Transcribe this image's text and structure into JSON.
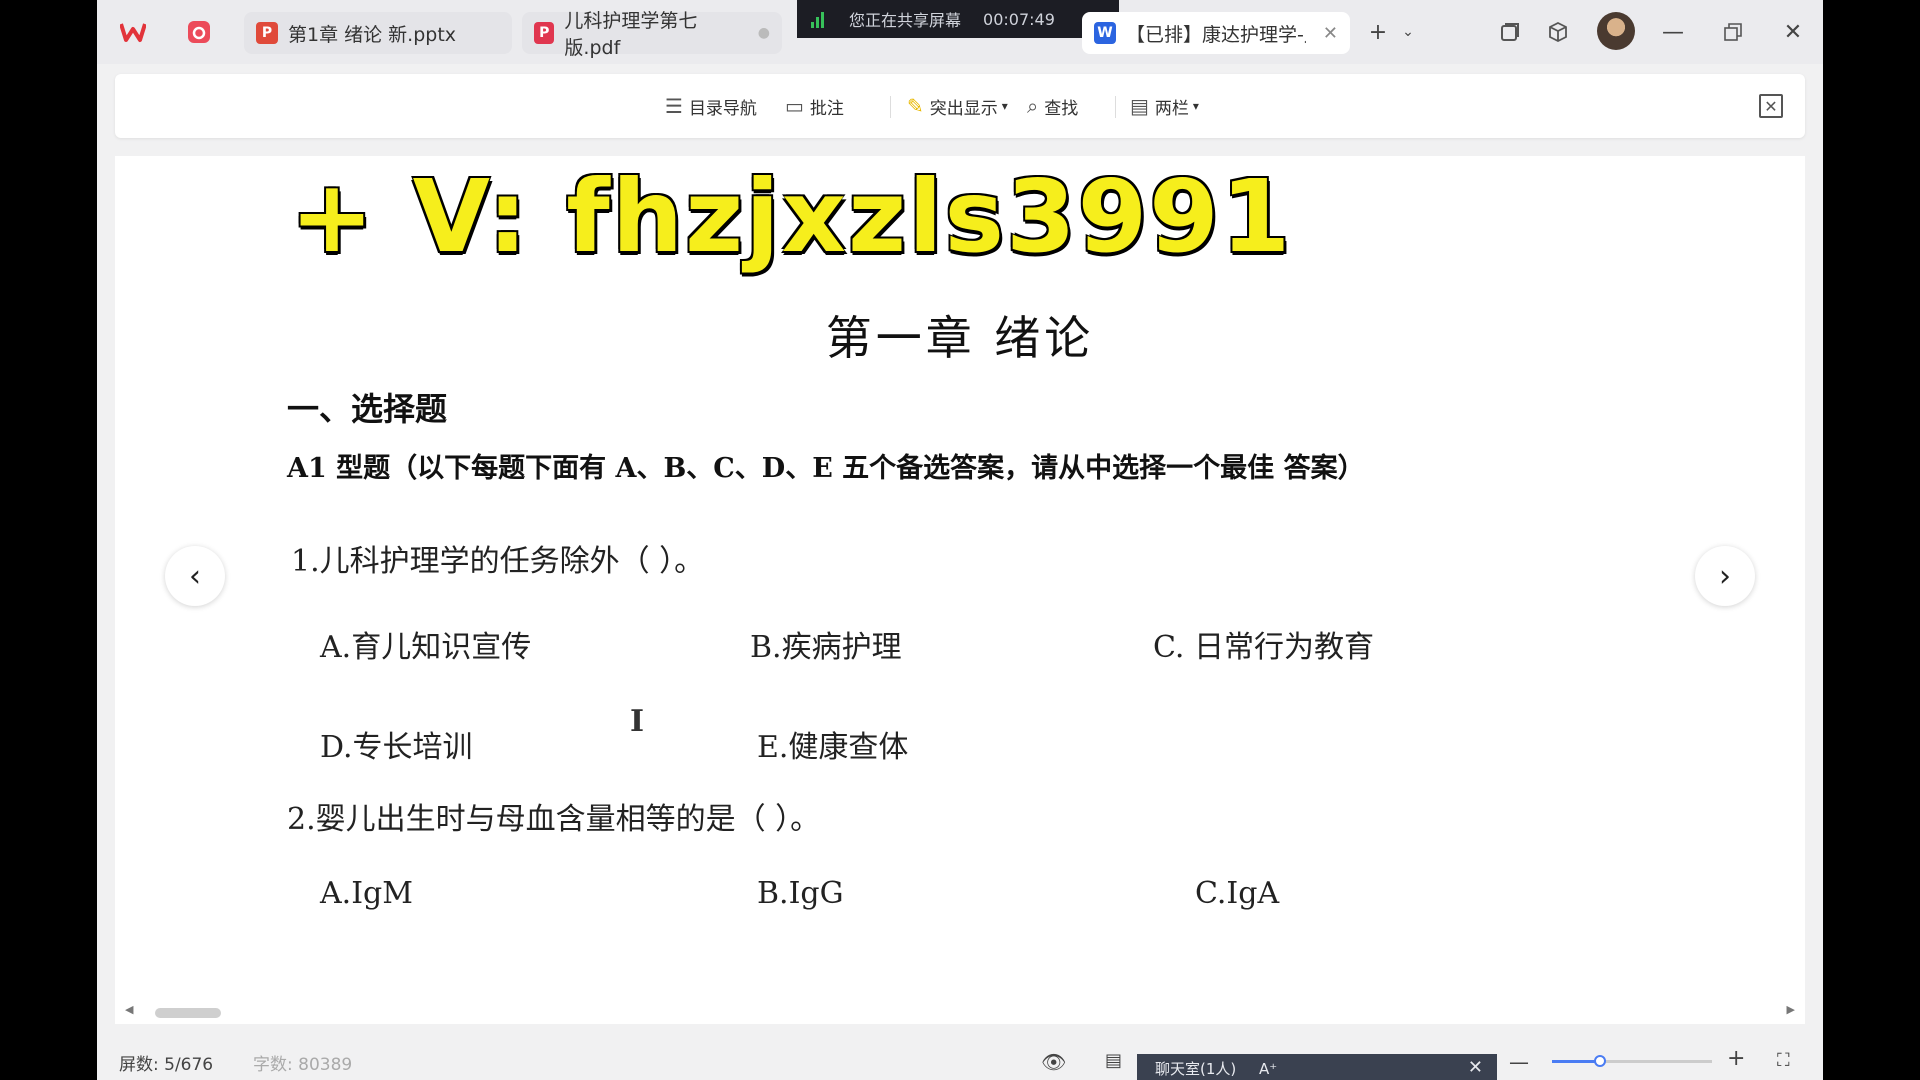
{
  "tabs": [
    {
      "label": "第1章 绪论 新.pptx",
      "icon": "ppt-icon",
      "color": "#e04a3a"
    },
    {
      "label": "儿科护理学第七版.pdf",
      "icon": "pdf-icon",
      "color": "#e0364f"
    },
    {
      "label": "【已排】康达护理学-儿",
      "icon": "doc-icon",
      "color": "#2b64e0"
    }
  ],
  "share": {
    "text": "您正在共享屏幕",
    "time": "00:07:49"
  },
  "toolbar": {
    "toc": "目录导航",
    "comment": "批注",
    "highlight": "突出显示",
    "find": "查找",
    "columns": "两栏"
  },
  "doc": {
    "watermark": "+ V:  fhzjxzls3991",
    "chapter_title": "第一章  绪论",
    "section": "一、选择题",
    "instruction": "A1 型题（以下每题下面有 A、B、C、D、E 五个备选答案，请从中选择一个最佳  答案）",
    "q1": {
      "stem": "1.儿科护理学的任务除外（        ）。",
      "a": "A.育儿知识宣传",
      "b": "B.疾病护理",
      "c": "C. 日常行为教育",
      "d": "D.专长培训",
      "e": "E.健康查体"
    },
    "q2": {
      "stem": "2.婴儿出生时与母血含量相等的是（        ）。",
      "a": "A.IgM",
      "b": "B.IgG",
      "c": "C.IgA"
    }
  },
  "status": {
    "screens": "屏数: 5/676",
    "words": "字数: 80389",
    "chat": "聊天室(1人)",
    "chat_font": "A⁺",
    "zoom_level": 0.3
  },
  "colors": {
    "accent": "#4a7cf3",
    "watermark": "#f6ee1c"
  }
}
